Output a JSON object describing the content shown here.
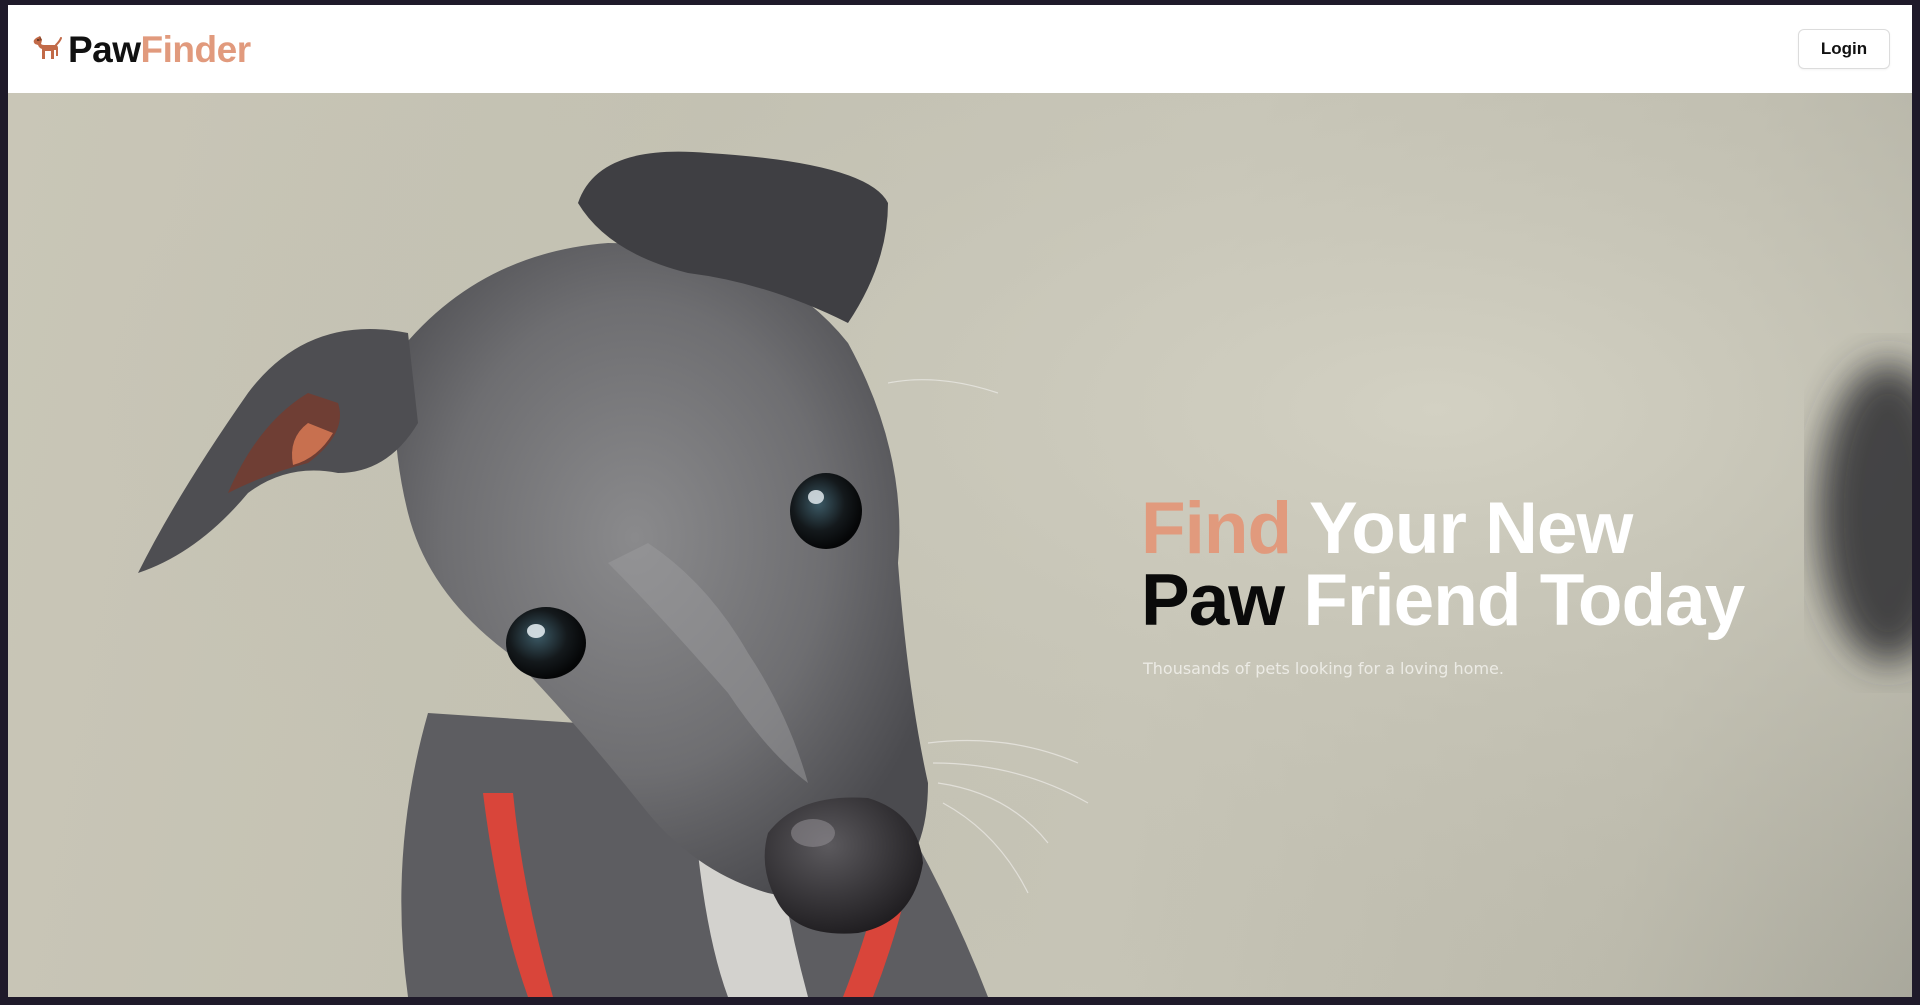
{
  "header": {
    "brand_part1": "Paw",
    "brand_part2": "Finder",
    "login_label": "Login"
  },
  "hero": {
    "headline_word1": "Find",
    "headline_word2": " Your New",
    "headline_word3": "Paw",
    "headline_word4": " Friend Today",
    "subtitle": "Thousands of pets looking for a loving home.",
    "image_subject": "grey whippet puppy with red collar"
  },
  "colors": {
    "accent": "#e19a7d",
    "text_dark": "#111111",
    "text_light": "#ffffff",
    "frame": "#1f1a2a"
  }
}
